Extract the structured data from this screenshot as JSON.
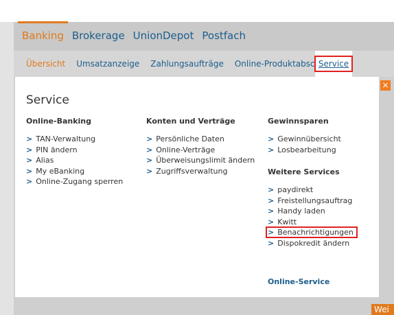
{
  "mainnav": [
    "Banking",
    "Brokerage",
    "UnionDepot",
    "Postfach"
  ],
  "subnav": [
    "Übersicht",
    "Umsatzanzeige",
    "Zahlungsaufträge",
    "Online-Produktabschluss",
    "Service"
  ],
  "panel": {
    "title": "Service",
    "close": "×",
    "col1": {
      "heading": "Online-Banking",
      "items": [
        "TAN-Verwaltung",
        "PIN ändern",
        "Alias",
        "My eBanking",
        "Online-Zugang sperren"
      ]
    },
    "col2": {
      "heading": "Konten und Verträge",
      "items": [
        "Persönliche Daten",
        "Online-Verträge",
        "Überweisungslimit ändern",
        "Zugriffsverwaltung"
      ]
    },
    "col3": {
      "heading1": "Gewinnsparen",
      "items1": [
        "Gewinnübersicht",
        "Losbearbeitung"
      ],
      "heading2": "Weitere Services",
      "items2": [
        "paydirekt",
        "Freistellungsauftrag",
        "Handy laden",
        "Kwitt",
        "Benachrichtigungen",
        "Dispokredit ändern"
      ],
      "online_service": "Online-Service"
    }
  },
  "corner_button": "Wei"
}
